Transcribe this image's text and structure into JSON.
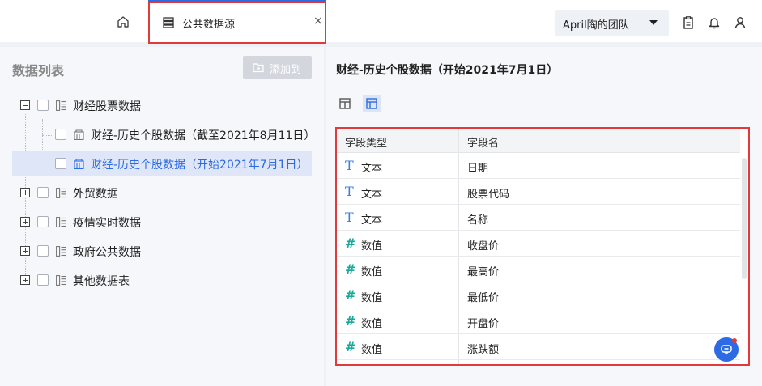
{
  "header": {
    "tab_label": "公共数据源",
    "tab_close": "×",
    "team_label": "April陶的团队"
  },
  "left": {
    "title": "数据列表",
    "add_button": "添加到",
    "tree": [
      {
        "label": "财经股票数据",
        "expanded": true,
        "children": [
          {
            "label": "财经-历史个股数据（截至2021年8月11日）",
            "selected": false
          },
          {
            "label": "财经-历史个股数据（开始2021年7月1日）",
            "selected": true
          }
        ]
      },
      {
        "label": "外贸数据",
        "expanded": false
      },
      {
        "label": "疫情实时数据",
        "expanded": false
      },
      {
        "label": "政府公共数据",
        "expanded": false
      },
      {
        "label": "其他数据表",
        "expanded": false
      }
    ]
  },
  "right": {
    "title": "财经-历史个股数据（开始2021年7月1日）",
    "columns": [
      "字段类型",
      "字段名"
    ],
    "rows": [
      {
        "type_icon": "T",
        "type": "文本",
        "name": "日期"
      },
      {
        "type_icon": "T",
        "type": "文本",
        "name": "股票代码"
      },
      {
        "type_icon": "T",
        "type": "文本",
        "name": "名称"
      },
      {
        "type_icon": "#",
        "type": "数值",
        "name": "收盘价"
      },
      {
        "type_icon": "#",
        "type": "数值",
        "name": "最高价"
      },
      {
        "type_icon": "#",
        "type": "数值",
        "name": "最低价"
      },
      {
        "type_icon": "#",
        "type": "数值",
        "name": "开盘价"
      },
      {
        "type_icon": "#",
        "type": "数值",
        "name": "涨跌额"
      }
    ]
  },
  "colors": {
    "accent": "#2d6be4",
    "highlight_border": "#e03b3b",
    "number_icon": "#1aa89a"
  }
}
